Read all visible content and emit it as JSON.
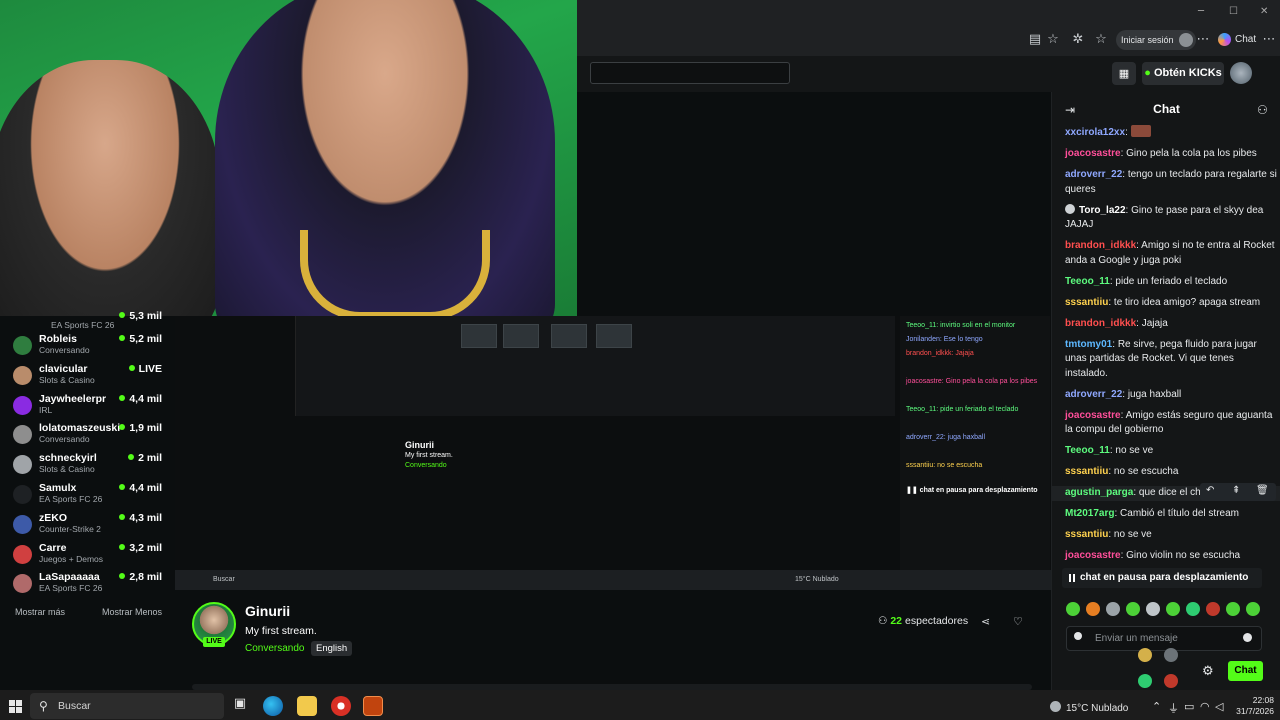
{
  "browser": {
    "signin_label": "Iniciar sesión",
    "copilot_label": "Chat"
  },
  "header": {
    "kicks_label": "Obtén KICKs"
  },
  "channels": [
    {
      "name": "Robleis",
      "category": "Conversando",
      "viewers": "5,2 mil",
      "color": "#2f7d3f"
    },
    {
      "name": "clavicular",
      "category": "Slots & Casino",
      "viewers": "LIVE",
      "color": "#b98c6b"
    },
    {
      "name": "Jaywheelerpr",
      "category": "IRL",
      "viewers": "4,4 mil",
      "color": "#8a2be2"
    },
    {
      "name": "lolatomaszeuski",
      "category": "Conversando",
      "viewers": "1,9 mil",
      "color": "#8e8e8e"
    },
    {
      "name": "schneckyirl",
      "category": "Slots & Casino",
      "viewers": "2 mil",
      "color": "#a0a4a8"
    },
    {
      "name": "Samulx",
      "category": "EA Sports FC 26",
      "viewers": "4,4 mil",
      "color": "#1e2124"
    },
    {
      "name": "zEKO",
      "category": "Counter-Strike 2",
      "viewers": "4,3 mil",
      "color": "#3d5aa8"
    },
    {
      "name": "Carre",
      "category": "Juegos + Demos",
      "viewers": "3,2 mil",
      "color": "#d04040"
    },
    {
      "name": "LaSapaaaaa",
      "category": "EA Sports FC 26",
      "viewers": "2,8 mil",
      "color": "#b06a6a"
    }
  ],
  "partial_channel": {
    "category": "EA Sports FC 26",
    "viewers": "5,3 mil"
  },
  "sidebar": {
    "show_more": "Mostrar más",
    "show_less": "Mostrar Menos"
  },
  "stream": {
    "streamer": "Ginurii",
    "title": "My first stream.",
    "category": "Conversando",
    "language": "English",
    "viewers_count": "22",
    "viewers_label": "espectadores",
    "live_label": "LIVE"
  },
  "chat": {
    "title": "Chat",
    "messages": [
      {
        "user": "xxcirola12xx",
        "text": "",
        "color": "#8fa8ff",
        "emote": true
      },
      {
        "user": "joacosastre",
        "text": "Gino pela la cola pa los pibes",
        "color": "#ff4f9a"
      },
      {
        "user": "adroverr_22",
        "text": "tengo un teclado para regalarte si queres",
        "color": "#8fa8ff"
      },
      {
        "user": "Toro_la22",
        "text": "Gino te pase para el skyy dea JAJAJ",
        "color": "#ffffff",
        "badge": true
      },
      {
        "user": "brandon_idkkk",
        "text": "Amigo si no te entra al Rocket anda a Google y juga poki",
        "color": "#ff4f4f"
      },
      {
        "user": "Teeoo_11",
        "text": "pide un feriado el teclado",
        "color": "#5dfc7f"
      },
      {
        "user": "sssantiiu",
        "text": "te tiro idea amigo? apaga stream",
        "color": "#ffd24f"
      },
      {
        "user": "brandon_idkkk",
        "text": "Jajaja",
        "color": "#ff4f4f"
      },
      {
        "user": "tmtomy01",
        "text": "Re sirve, pega fluido para jugar unas partidas de Rocket. Vi que tenes instalado.",
        "color": "#5db8ff"
      },
      {
        "user": "adroverr_22",
        "text": "juga haxball",
        "color": "#8fa8ff"
      },
      {
        "user": "joacosastre",
        "text": "Amigo estás seguro que aguanta la compu del gobierno",
        "color": "#ff4f9a"
      },
      {
        "user": "Teeoo_11",
        "text": "no se ve",
        "color": "#5dfc7f"
      },
      {
        "user": "sssantiiu",
        "text": "no se escucha",
        "color": "#ffd24f"
      },
      {
        "user": "agustin_parga",
        "text": "que dice el chaval",
        "color": "#5dfc7f",
        "highlight": true
      },
      {
        "user": "Mt2017arg",
        "text": "Cambió el título del stream",
        "color": "#5dfc7f"
      },
      {
        "user": "sssantiiu",
        "text": "no se ve",
        "color": "#ffd24f"
      },
      {
        "user": "joacosastre",
        "text": "Gino violin no se escucha",
        "color": "#ff4f9a"
      }
    ],
    "paused_label": "chat en pausa para desplazamiento",
    "input_placeholder": "Enviar un mensaje",
    "send_label": "Chat"
  },
  "taskbar": {
    "search_label": "Buscar",
    "weather": "15°C  Nublado",
    "time": "22:08",
    "date": "31/7/2026"
  }
}
